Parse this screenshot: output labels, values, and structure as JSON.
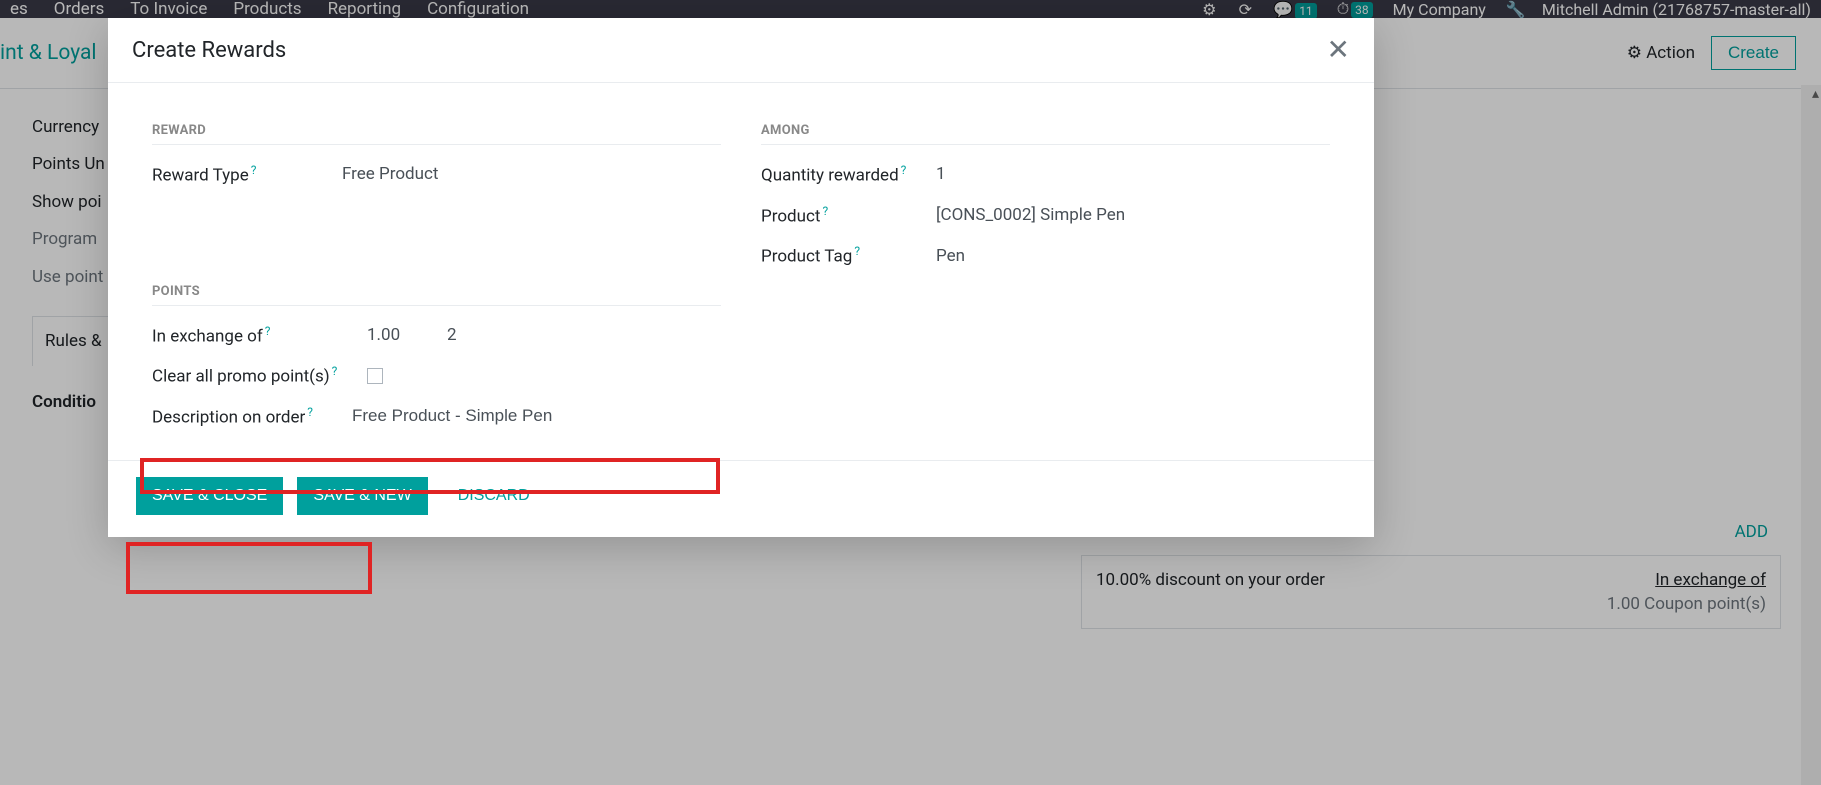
{
  "topbar": {
    "menu": [
      "es",
      "Orders",
      "To Invoice",
      "Products",
      "Reporting",
      "Configuration"
    ],
    "msg_count": "11",
    "clock_count": "38",
    "company": "My Company",
    "user": "Mitchell Admin (21768757-master-all)"
  },
  "page": {
    "breadcrumb": "int & Loyal",
    "action_label": "Action",
    "create_label": "Create"
  },
  "bg_form": {
    "currency": "Currency",
    "points_unit": "Points Un",
    "show_points": "Show poi",
    "program": "Program",
    "use_point": "Use point",
    "tab": "Rules &",
    "conditions": "Conditio"
  },
  "bg_right": {
    "add": "ADD",
    "line": "10.00% discount on your order",
    "ex1": "In exchange of",
    "ex2": "1.00 Coupon point(s)"
  },
  "modal": {
    "title": "Create Rewards",
    "sections": {
      "reward": "REWARD",
      "among": "AMONG",
      "points": "POINTS"
    },
    "fields": {
      "reward_type_label": "Reward Type",
      "reward_type_value": "Free Product",
      "qty_label": "Quantity rewarded",
      "qty_value": "1",
      "product_label": "Product",
      "product_value": "[CONS_0002] Simple Pen",
      "tag_label": "Product Tag",
      "tag_value": "Pen",
      "exchange_label": "In exchange of",
      "exchange_v1": "1.00",
      "exchange_v2": "2",
      "clear_label": "Clear all promo point(s)",
      "desc_label": "Description on order",
      "desc_value": "Free Product - Simple Pen"
    },
    "buttons": {
      "save_close": "SAVE & CLOSE",
      "save_new": "SAVE & NEW",
      "discard": "DISCARD"
    }
  }
}
